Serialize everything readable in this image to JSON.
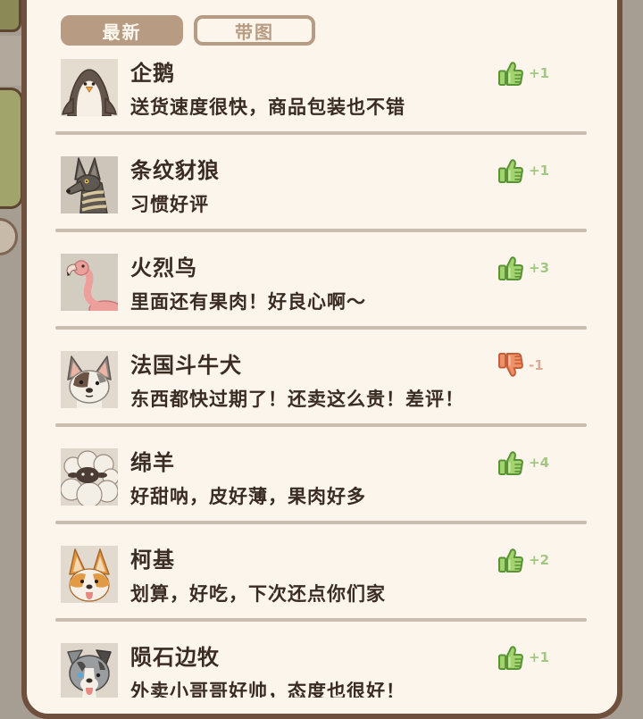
{
  "tabs": {
    "latest": {
      "label": "最新",
      "selected": true
    },
    "with_images": {
      "label": "带图",
      "selected": false
    }
  },
  "reviews": [
    {
      "name": "企鹅",
      "text": "送货速度很快，商品包装也不错",
      "icon": "thumbs-up-icon",
      "count": "+1",
      "avatar": "penguin-icon"
    },
    {
      "name": "条纹豺狼",
      "text": "习惯好评",
      "icon": "thumbs-up-icon",
      "count": "+1",
      "avatar": "striped-jackal-icon"
    },
    {
      "name": "火烈鸟",
      "text": "里面还有果肉！好良心啊～",
      "icon": "thumbs-up-icon",
      "count": "+3",
      "avatar": "flamingo-icon"
    },
    {
      "name": "法国斗牛犬",
      "text": "东西都快过期了！还卖这么贵！差评！",
      "icon": "thumbs-down-icon",
      "count": "-1",
      "avatar": "french-bulldog-icon"
    },
    {
      "name": "绵羊",
      "text": "好甜呐，皮好薄，果肉好多",
      "icon": "thumbs-up-icon",
      "count": "+4",
      "avatar": "sheep-icon"
    },
    {
      "name": "柯基",
      "text": "划算，好吃，下次还点你们家",
      "icon": "thumbs-up-icon",
      "count": "+2",
      "avatar": "corgi-icon"
    },
    {
      "name": "陨石边牧",
      "text": "外卖小哥哥好帅，态度也很好！",
      "icon": "thumbs-up-icon",
      "count": "+1",
      "avatar": "border-collie-icon"
    }
  ],
  "colors": {
    "panel_bg": "#fcf5ec",
    "tab_accent": "#b79b82",
    "text": "#3a2c23",
    "positive_count": "#a3c783",
    "negative_count": "#dcab96",
    "border": "#6f4f3d",
    "divider": "#c9bdaf"
  }
}
